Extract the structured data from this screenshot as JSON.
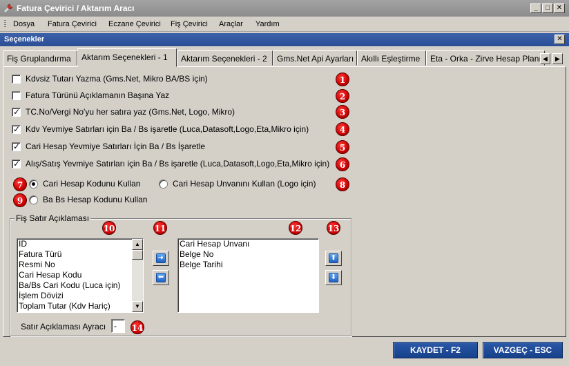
{
  "window": {
    "title": "Fatura Çevirici / Aktarım Aracı",
    "minimize": "_",
    "maximize": "□",
    "close": "✕"
  },
  "menu": [
    "Dosya",
    "Fatura Çevirici",
    "Eczane Çevirici",
    "Fiş Çevirici",
    "Araçlar",
    "Yardım"
  ],
  "panel": {
    "title": "Seçenekler",
    "close": "✕"
  },
  "tabs": [
    "Fiş Gruplandırma",
    "Aktarım Seçenekleri - 1",
    "Aktarım Seçenekleri - 2",
    "Gms.Net Api Ayarları",
    "Akıllı Eşleştirme",
    "Eta - Orka - Zirve Hesap Planı"
  ],
  "active_tab": 1,
  "tab_scroll": {
    "left": "◀",
    "right": "▶"
  },
  "checkboxes": [
    {
      "label": "Kdvsiz Tutarı Yazma (Gms.Net, Mikro BA/BS için)",
      "checked": false,
      "badge": "1"
    },
    {
      "label": "Fatura Türünü Açıklamanın Başına Yaz",
      "checked": false,
      "badge": "2"
    },
    {
      "label": "TC.No/Vergi No'yu her satıra yaz (Gms.Net, Logo, Mikro)",
      "checked": true,
      "badge": "3"
    },
    {
      "label": "Kdv Yevmiye Satırları için Ba / Bs işaretle (Luca,Datasoft,Logo,Eta,Mikro için)",
      "checked": true,
      "badge": "4"
    },
    {
      "label": "Cari Hesap Yevmiye Satırları İçin Ba / Bs İşaretle",
      "checked": true,
      "badge": "5"
    },
    {
      "label": "Alış/Satış Yevmiye Satırları için Ba / Bs işaretle (Luca,Datasoft,Logo,Eta,Mikro için)",
      "checked": true,
      "badge": "6"
    }
  ],
  "check_mark": "✓",
  "radios": [
    {
      "label": "Cari Hesap Kodunu Kullan",
      "selected": true,
      "badge": "7"
    },
    {
      "label": "Cari Hesap Unvanını Kullan (Logo için)",
      "selected": false,
      "badge": "8"
    },
    {
      "label": "Ba Bs Hesap Kodunu Kullan",
      "selected": false,
      "badge": "9"
    }
  ],
  "group": {
    "title": "Fiş Satır Açıklaması",
    "badges": [
      "10",
      "11",
      "12",
      "13"
    ],
    "available_items": [
      "ID",
      "Fatura Türü",
      "Resmi No",
      "Cari Hesap Kodu",
      "Ba/Bs Cari Kodu (Luca için)",
      "İşlem Dövizi",
      "Toplam Tutar (Kdv Hariç)"
    ],
    "selected_items": [
      "Cari Hesap Unvanı",
      "Belge No",
      "Belge Tarihi"
    ],
    "move_right": "➜",
    "move_left": "⬅",
    "move_up": "⬆",
    "move_down": "⬇",
    "scroll_up": "▲",
    "scroll_down": "▼"
  },
  "separator": {
    "label": "Satır Açıklaması Ayracı",
    "value": "-",
    "badge": "14"
  },
  "buttons": {
    "save": "KAYDET - F2",
    "cancel": "VAZGEÇ - ESC"
  }
}
